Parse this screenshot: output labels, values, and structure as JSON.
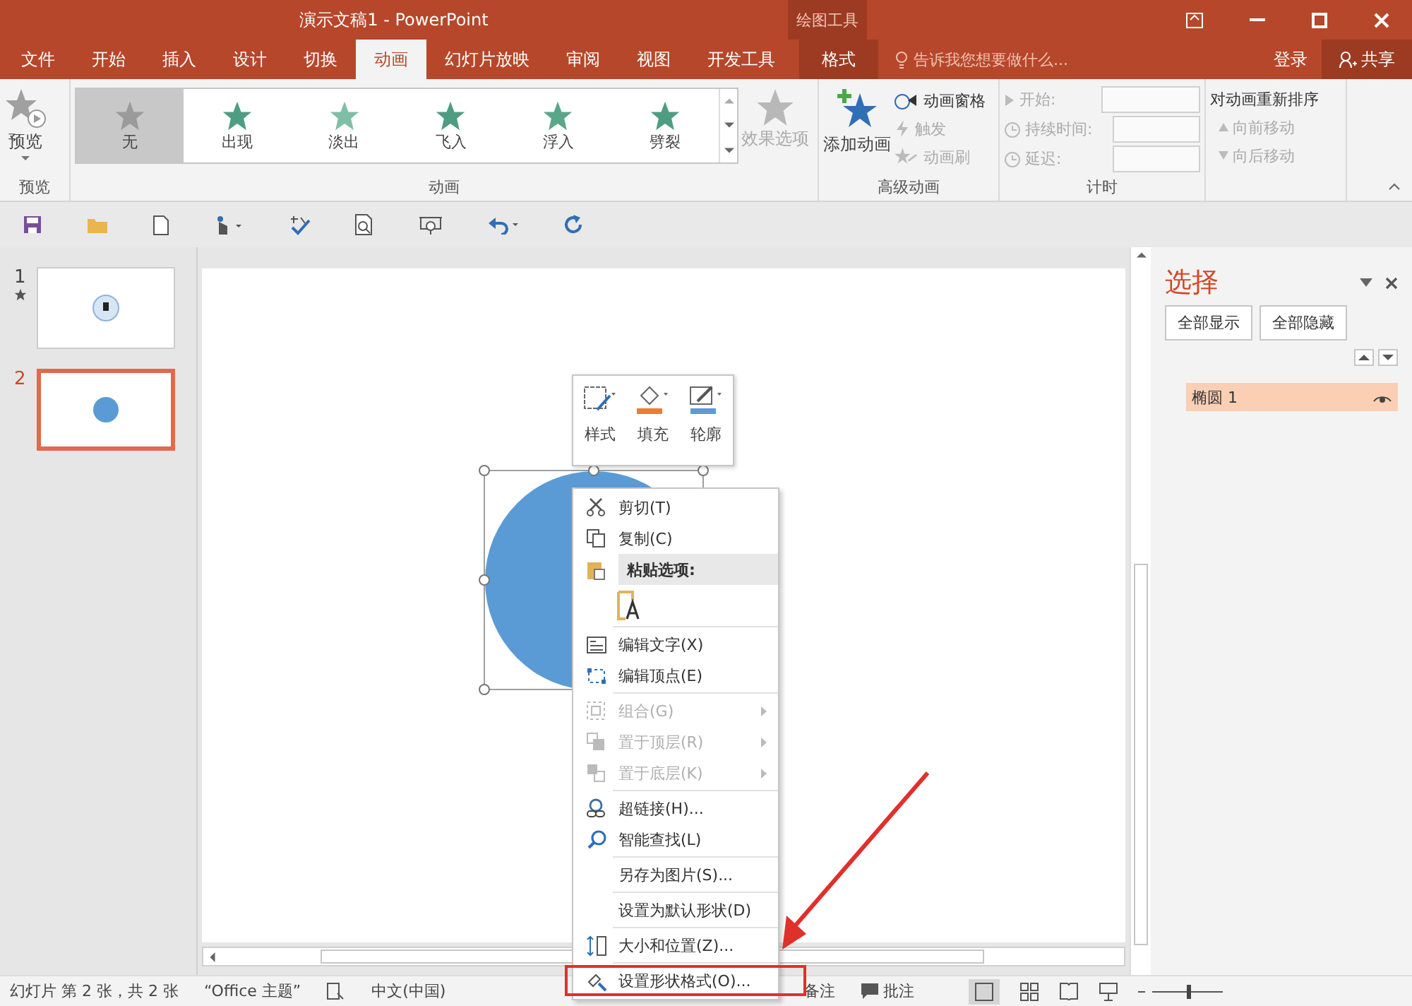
{
  "window": {
    "title": "演示文稿1 - PowerPoint",
    "context_group": "绘图工具"
  },
  "tabs": [
    {
      "label": "文件",
      "selected": false
    },
    {
      "label": "开始",
      "selected": false
    },
    {
      "label": "插入",
      "selected": false
    },
    {
      "label": "设计",
      "selected": false
    },
    {
      "label": "切换",
      "selected": false
    },
    {
      "label": "动画",
      "selected": true
    },
    {
      "label": "幻灯片放映",
      "selected": false
    },
    {
      "label": "审阅",
      "selected": false
    },
    {
      "label": "视图",
      "selected": false
    },
    {
      "label": "开发工具",
      "selected": false
    }
  ],
  "context_tab": {
    "label": "格式",
    "selected": false
  },
  "tell_me": {
    "placeholder": "告诉我您想要做什么..."
  },
  "sign_in": "登录",
  "share": "共享",
  "ribbon": {
    "preview": {
      "label": "预览",
      "group": "预览"
    },
    "gallery": {
      "group": "动画",
      "items": [
        {
          "label": "无",
          "kind": "none",
          "selected": true
        },
        {
          "label": "出现",
          "kind": "appear",
          "selected": false
        },
        {
          "label": "淡出",
          "kind": "fade",
          "selected": false
        },
        {
          "label": "飞入",
          "kind": "fly",
          "selected": false
        },
        {
          "label": "浮入",
          "kind": "float",
          "selected": false
        },
        {
          "label": "劈裂",
          "kind": "split",
          "selected": false
        }
      ]
    },
    "effect_options": {
      "label": "效果选项",
      "disabled": true
    },
    "advanced": {
      "group": "高级动画",
      "add": "添加动画",
      "items": [
        {
          "label": "动画窗格",
          "disabled": false
        },
        {
          "label": "触发",
          "disabled": true
        },
        {
          "label": "动画刷",
          "disabled": true
        }
      ]
    },
    "timing": {
      "group": "计时",
      "rows": [
        {
          "label": "开始:",
          "kind": "dropdown",
          "disabled": true
        },
        {
          "label": "持续时间:",
          "kind": "spin",
          "disabled": true
        },
        {
          "label": "延迟:",
          "kind": "spin",
          "disabled": true
        }
      ]
    },
    "reorder": {
      "title": "对动画重新排序",
      "items": [
        {
          "label": "向前移动",
          "disabled": true
        },
        {
          "label": "向后移动",
          "disabled": true
        }
      ]
    }
  },
  "slides": [
    {
      "number": "1",
      "animated": true,
      "selected": false
    },
    {
      "number": "2",
      "animated": false,
      "selected": true
    }
  ],
  "mini_toolbar": [
    {
      "label": "样式"
    },
    {
      "label": "填充"
    },
    {
      "label": "轮廓"
    }
  ],
  "context_menu": [
    {
      "label": "剪切(T)",
      "kind": "item",
      "disabled": false,
      "submenu": false,
      "annotated": false
    },
    {
      "label": "复制(C)",
      "kind": "item",
      "disabled": false,
      "submenu": false,
      "annotated": false
    },
    {
      "label": "粘贴选项:",
      "kind": "header"
    },
    {
      "kind": "paste_option"
    },
    {
      "kind": "separator"
    },
    {
      "label": "编辑文字(X)",
      "kind": "item",
      "disabled": false,
      "submenu": false,
      "annotated": false
    },
    {
      "label": "编辑顶点(E)",
      "kind": "item",
      "disabled": false,
      "submenu": false,
      "annotated": false
    },
    {
      "kind": "separator"
    },
    {
      "label": "组合(G)",
      "kind": "item",
      "disabled": true,
      "submenu": true,
      "annotated": false
    },
    {
      "label": "置于顶层(R)",
      "kind": "item",
      "disabled": true,
      "submenu": true,
      "annotated": false
    },
    {
      "label": "置于底层(K)",
      "kind": "item",
      "disabled": true,
      "submenu": true,
      "annotated": false
    },
    {
      "kind": "separator"
    },
    {
      "label": "超链接(H)...",
      "kind": "item",
      "disabled": false,
      "submenu": false,
      "annotated": false
    },
    {
      "label": "智能查找(L)",
      "kind": "item",
      "disabled": false,
      "submenu": false,
      "annotated": false
    },
    {
      "kind": "separator"
    },
    {
      "label": "另存为图片(S)...",
      "kind": "item",
      "disabled": false,
      "submenu": false,
      "annotated": false
    },
    {
      "kind": "separator"
    },
    {
      "label": "设置为默认形状(D)",
      "kind": "item",
      "disabled": false,
      "submenu": false,
      "annotated": false
    },
    {
      "kind": "separator"
    },
    {
      "label": "大小和位置(Z)...",
      "kind": "item",
      "disabled": false,
      "submenu": false,
      "annotated": false
    },
    {
      "kind": "separator"
    },
    {
      "label": "设置形状格式(O)...",
      "kind": "item",
      "disabled": false,
      "submenu": false,
      "annotated": true
    }
  ],
  "selection_pane": {
    "title": "选择",
    "buttons": [
      "全部显示",
      "全部隐藏"
    ],
    "items": [
      {
        "label": "椭圆 1",
        "selected": true,
        "visible": true
      }
    ]
  },
  "status_bar": {
    "slide_info": "幻灯片 第 2 张，共 2 张",
    "theme": "“Office 主题”",
    "language": "中文(中国)",
    "notes": "备注",
    "comments": "批注",
    "zoom": {
      "level": 0.6
    }
  }
}
